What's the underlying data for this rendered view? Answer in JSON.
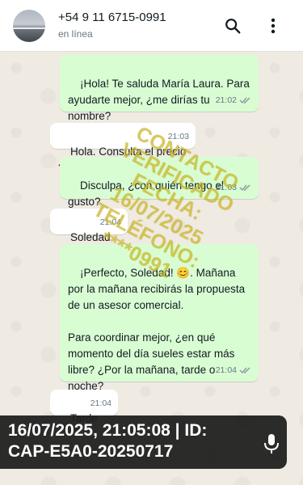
{
  "header": {
    "contact_name": "+54 9 11 6715-0991",
    "status": "en línea"
  },
  "messages": [
    {
      "direction": "out",
      "text": "¡Hola! Te saluda María Laura. Para ayudarte mejor, ¿me dirías tu nombre?",
      "time": "21:02",
      "read": true
    },
    {
      "direction": "in",
      "text": "Hola. Consulta el precio ?",
      "time": "21:03"
    },
    {
      "direction": "out",
      "text": "Disculpa, ¿con quién tengo el gusto?",
      "time": "21:03",
      "read": true
    },
    {
      "direction": "in",
      "text": "Soledad",
      "time": "21:04"
    },
    {
      "direction": "out",
      "text": "¡Perfecto, Soledad! 😊. Mañana por la mañana recibirás la propuesta de un asesor comercial.\n\nPara coordinar mejor, ¿en qué momento del día sueles estar más libre? ¿Por la mañana, tarde o noche?",
      "time": "21:04",
      "read": true
    },
    {
      "direction": "in",
      "text": "Tarde",
      "time": "21:04"
    }
  ],
  "watermark": {
    "lines": [
      "CONTACTO",
      "VERIFICADO",
      "FECHA:",
      "16/07/2025",
      "TELÉFONO:",
      "****0991"
    ]
  },
  "stamp": {
    "text": "16/07/2025, 21:05:08 | ID: CAP-E5A0-20250717"
  },
  "colors": {
    "outgoing_bubble": "#d9fdd3",
    "incoming_bubble": "#ffffff",
    "read_ticks": "#53bdeb",
    "chat_background": "#efeae2"
  },
  "icons": [
    "search-icon",
    "more-vertical-icon",
    "double-check-icon",
    "microphone-icon"
  ]
}
